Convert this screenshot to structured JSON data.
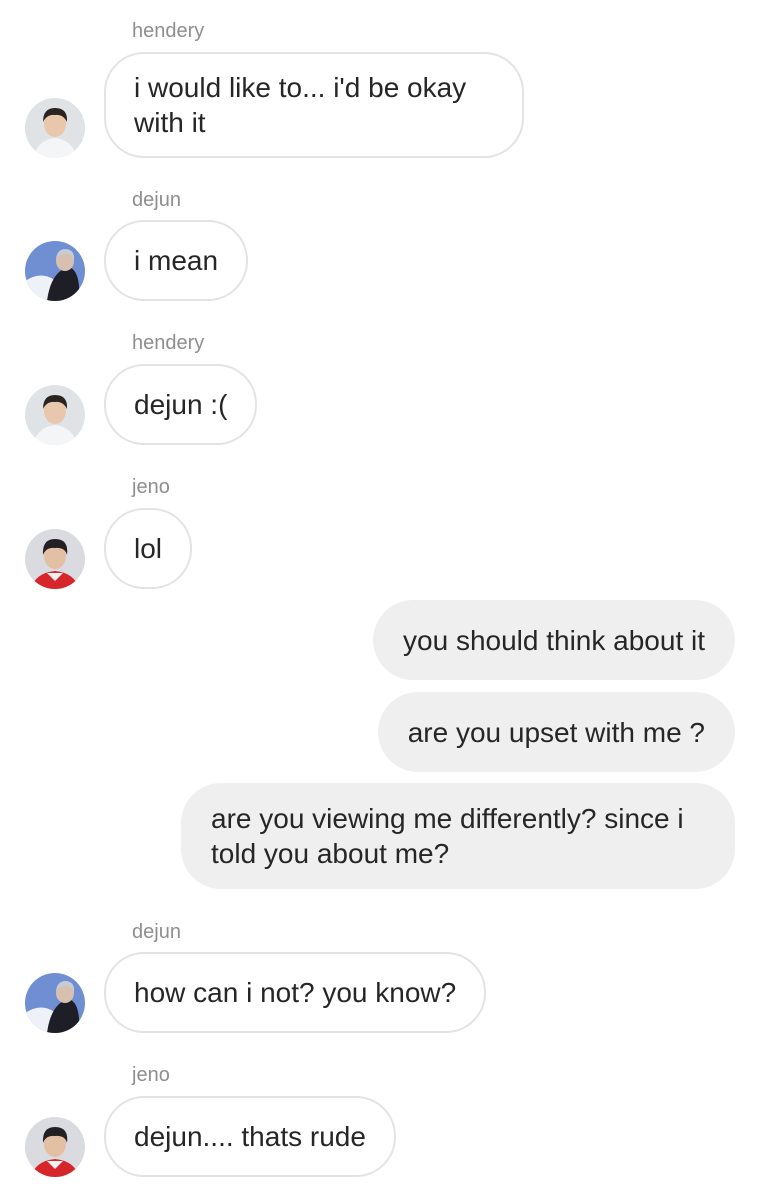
{
  "thread": {
    "messages": [
      {
        "sender": "hendery",
        "avatar": "hendery-avatar",
        "text": "i would like to... i'd be okay with it",
        "direction": "incoming"
      },
      {
        "sender": "dejun",
        "avatar": "dejun-avatar",
        "text": "i mean",
        "direction": "incoming"
      },
      {
        "sender": "hendery",
        "avatar": "hendery-avatar",
        "text": "dejun :(",
        "direction": "incoming"
      },
      {
        "sender": "jeno",
        "avatar": "jeno-avatar",
        "text": "lol",
        "direction": "incoming"
      },
      {
        "text": "you should think about it",
        "direction": "outgoing"
      },
      {
        "text": "are you upset with me ?",
        "direction": "outgoing"
      },
      {
        "text": "are you viewing me differently? since i told you about me?",
        "direction": "outgoing"
      },
      {
        "sender": "dejun",
        "avatar": "dejun-avatar",
        "text": "how can i not? you know?",
        "direction": "incoming"
      },
      {
        "sender": "jeno",
        "avatar": "jeno-avatar",
        "text": "dejun.... thats rude",
        "direction": "incoming"
      }
    ]
  },
  "colors": {
    "incoming_bubble_border": "#e3e3e3",
    "outgoing_bubble_fill": "#efefef",
    "sender_name": "#8e8e8e",
    "message_text": "#262626"
  }
}
